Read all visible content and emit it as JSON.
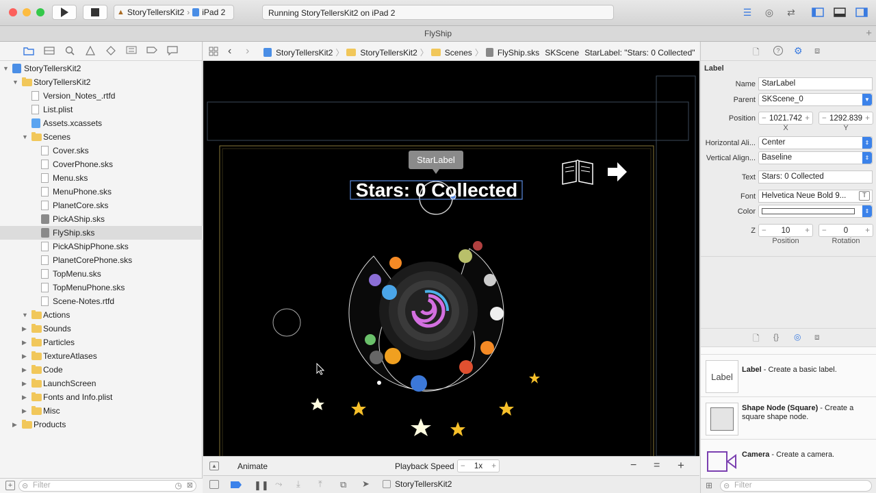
{
  "toolbar": {
    "scheme_project": "StoryTellersKit2",
    "scheme_device": "iPad 2",
    "status_text": "Running StoryTellersKit2 on iPad 2"
  },
  "tab": {
    "title": "FlyShip"
  },
  "navigator": {
    "items": [
      {
        "label": "StoryTellersKit2",
        "kind": "project",
        "level": 0,
        "disclosure": "open"
      },
      {
        "label": "StoryTellersKit2",
        "kind": "folder",
        "level": 1,
        "disclosure": "open"
      },
      {
        "label": "Version_Notes_.rtfd",
        "kind": "file",
        "level": 2
      },
      {
        "label": "List.plist",
        "kind": "file",
        "level": 2
      },
      {
        "label": "Assets.xcassets",
        "kind": "xcassets",
        "level": 2
      },
      {
        "label": "Scenes",
        "kind": "folder",
        "level": 2,
        "disclosure": "open"
      },
      {
        "label": "Cover.sks",
        "kind": "file",
        "level": 3
      },
      {
        "label": "CoverPhone.sks",
        "kind": "file",
        "level": 3
      },
      {
        "label": "Menu.sks",
        "kind": "file",
        "level": 3
      },
      {
        "label": "MenuPhone.sks",
        "kind": "file",
        "level": 3
      },
      {
        "label": "PlanetCore.sks",
        "kind": "file",
        "level": 3
      },
      {
        "label": "PickAShip.sks",
        "kind": "sks",
        "level": 3
      },
      {
        "label": "FlyShip.sks",
        "kind": "sks",
        "level": 3,
        "selected": true
      },
      {
        "label": "PickAShipPhone.sks",
        "kind": "file",
        "level": 3
      },
      {
        "label": "PlanetCorePhone.sks",
        "kind": "file",
        "level": 3
      },
      {
        "label": "TopMenu.sks",
        "kind": "file",
        "level": 3
      },
      {
        "label": "TopMenuPhone.sks",
        "kind": "file",
        "level": 3
      },
      {
        "label": "Scene-Notes.rtfd",
        "kind": "file",
        "level": 3
      },
      {
        "label": "Actions",
        "kind": "folder",
        "level": 2,
        "disclosure": "open"
      },
      {
        "label": "Sounds",
        "kind": "folder",
        "level": 2,
        "disclosure": "closed"
      },
      {
        "label": "Particles",
        "kind": "folder",
        "level": 2,
        "disclosure": "closed"
      },
      {
        "label": "TextureAtlases",
        "kind": "folder",
        "level": 2,
        "disclosure": "closed"
      },
      {
        "label": "Code",
        "kind": "folder",
        "level": 2,
        "disclosure": "closed"
      },
      {
        "label": "LaunchScreen",
        "kind": "folder",
        "level": 2,
        "disclosure": "closed"
      },
      {
        "label": "Fonts and Info.plist",
        "kind": "folder",
        "level": 2,
        "disclosure": "closed"
      },
      {
        "label": "Misc",
        "kind": "folder",
        "level": 2,
        "disclosure": "closed"
      },
      {
        "label": "Products",
        "kind": "folder",
        "level": 1,
        "disclosure": "closed"
      }
    ],
    "filter_placeholder": "Filter"
  },
  "jumpbar": {
    "crumbs": [
      "StoryTellersKit2",
      "StoryTellersKit2",
      "Scenes",
      "FlyShip.sks",
      "SKScene",
      "StarLabel: \"Stars: 0 Collected\""
    ]
  },
  "scene": {
    "tooltip": "StarLabel",
    "label_text": "Stars: 0 Collected"
  },
  "animbar": {
    "animate_label": "Animate",
    "playback_label": "Playback Speed",
    "speed_value": "1x"
  },
  "debugbar": {
    "target": "StoryTellersKit2"
  },
  "inspector": {
    "section_title": "Label",
    "name_label": "Name",
    "name_value": "StarLabel",
    "parent_label": "Parent",
    "parent_value": "SKScene_0",
    "position_label": "Position",
    "position_x": "1021.742",
    "position_y": "1292.839",
    "x_caption": "X",
    "y_caption": "Y",
    "halign_label": "Horizontal Ali...",
    "halign_value": "Center",
    "valign_label": "Vertical Align...",
    "valign_value": "Baseline",
    "text_label": "Text",
    "text_value": "Stars: 0 Collected",
    "font_label": "Font",
    "font_value": "Helvetica Neue Bold 9...",
    "color_label": "Color",
    "z_label": "Z",
    "z_position": "10",
    "z_rotation": "0",
    "z_position_caption": "Position",
    "z_rotation_caption": "Rotation"
  },
  "library": {
    "items": [
      {
        "title": "Label",
        "desc": " - Create a basic label.",
        "icon": "Label"
      },
      {
        "title": "Shape Node (Square)",
        "desc": " - Create a square shape node.",
        "icon": "square"
      },
      {
        "title": "Camera",
        "desc": " - Create a camera.",
        "icon": "camera"
      }
    ],
    "filter_placeholder": "Filter"
  },
  "colors": {
    "accent": "#3b82ea",
    "selection": "#dcdcdc",
    "canvas": "#000000",
    "folder": "#f1c75a"
  }
}
